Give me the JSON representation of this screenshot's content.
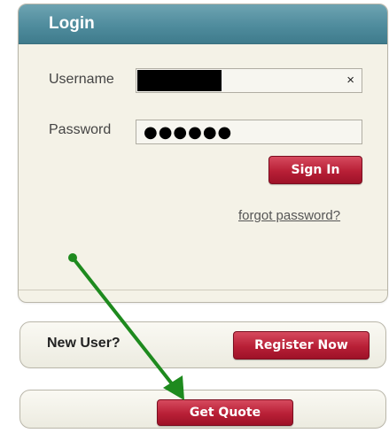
{
  "login": {
    "title": "Login",
    "username_label": "Username",
    "username_clear_symbol": "×",
    "password_label": "Password",
    "password_mask": "●●●●●●",
    "signin_label": "Sign In",
    "forgot_link": "forgot password?"
  },
  "new_user": {
    "label": "New User?",
    "register_label": "Register Now"
  },
  "quote": {
    "button_label": "Get Quote"
  },
  "colors": {
    "header_teal": "#4f8c9d",
    "button_red": "#b81f36",
    "panel_bg": "#f4f2e7",
    "annotation_arrow": "#1e8a1e"
  },
  "icons": {
    "clear": "close-icon",
    "annotation": "arrow-annotation"
  }
}
